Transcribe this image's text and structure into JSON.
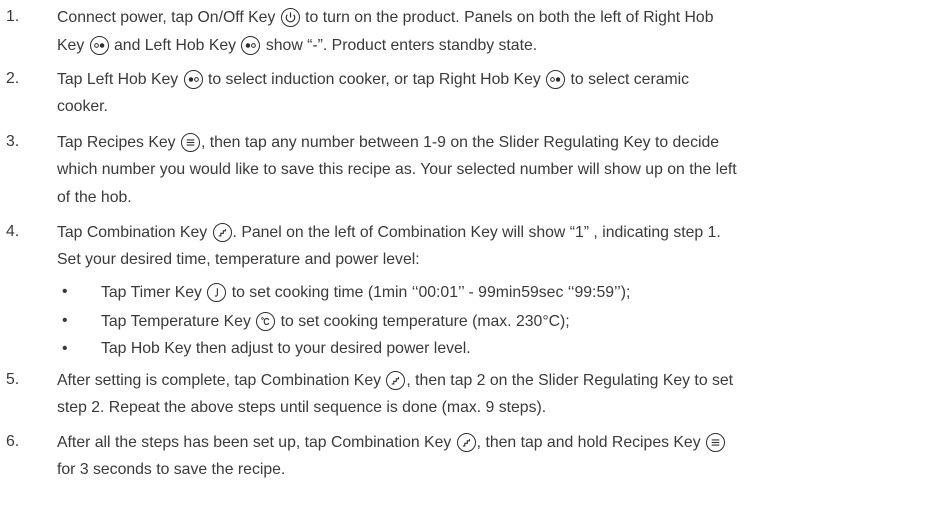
{
  "steps": [
    {
      "num": "1.",
      "parts": [
        "Connect power, tap On/Off Key ",
        " to turn on the product. Panels on both the left of Right Hob",
        "Key ",
        " and Left Hob Key ",
        " show “-”. Product enters standby state."
      ]
    },
    {
      "num": "2.",
      "parts": [
        "Tap Left Hob Key ",
        " to select induction cooker, or tap Right Hob Key ",
        " to select ceramic",
        "cooker."
      ]
    },
    {
      "num": "3.",
      "parts": [
        "Tap Recipes Key ",
        ", then tap any number between 1-9 on the Slider Regulating Key to decide",
        "which number you would like to save this recipe as. Your selected number will show up on the left",
        "of the hob."
      ]
    },
    {
      "num": "4.",
      "parts": [
        "Tap Combination Key ",
        ". Panel on the left of Combination Key will show “1” , indicating step 1.",
        "Set your desired time, temperature and power level:"
      ],
      "bullets": [
        {
          "mark": "•",
          "pre": "Tap Timer Key ",
          "post": " to set cooking time (1min ‘‘00:01’’ - 99min59sec ‘‘99:59’’);"
        },
        {
          "mark": "•",
          "pre": "Tap Temperature Key ",
          "post": " to set cooking temperature (max. 230°C);"
        },
        {
          "mark": "•",
          "pre": "Tap Hob Key then adjust to your desired power level.",
          "post": ""
        }
      ]
    },
    {
      "num": "5.",
      "parts": [
        "After setting is complete, tap Combination Key ",
        ", then tap 2 on the Slider Regulating Key to set",
        "step 2. Repeat the above steps until sequence is done (max. 9 steps)."
      ]
    },
    {
      "num": "6.",
      "parts": [
        "After all the steps has been set up, tap Combination Key ",
        ", then tap and hold Recipes Key ",
        "for 3 seconds to save the recipe."
      ]
    }
  ],
  "icons": {
    "power": "power-icon",
    "right_hob": "right-hob-icon",
    "left_hob": "left-hob-icon",
    "recipes": "recipes-icon",
    "combination": "combination-icon",
    "timer": "timer-icon",
    "temperature": "temperature-icon"
  },
  "colors": {
    "text": "#3a3a3a",
    "icon": "#2d2d2d"
  }
}
